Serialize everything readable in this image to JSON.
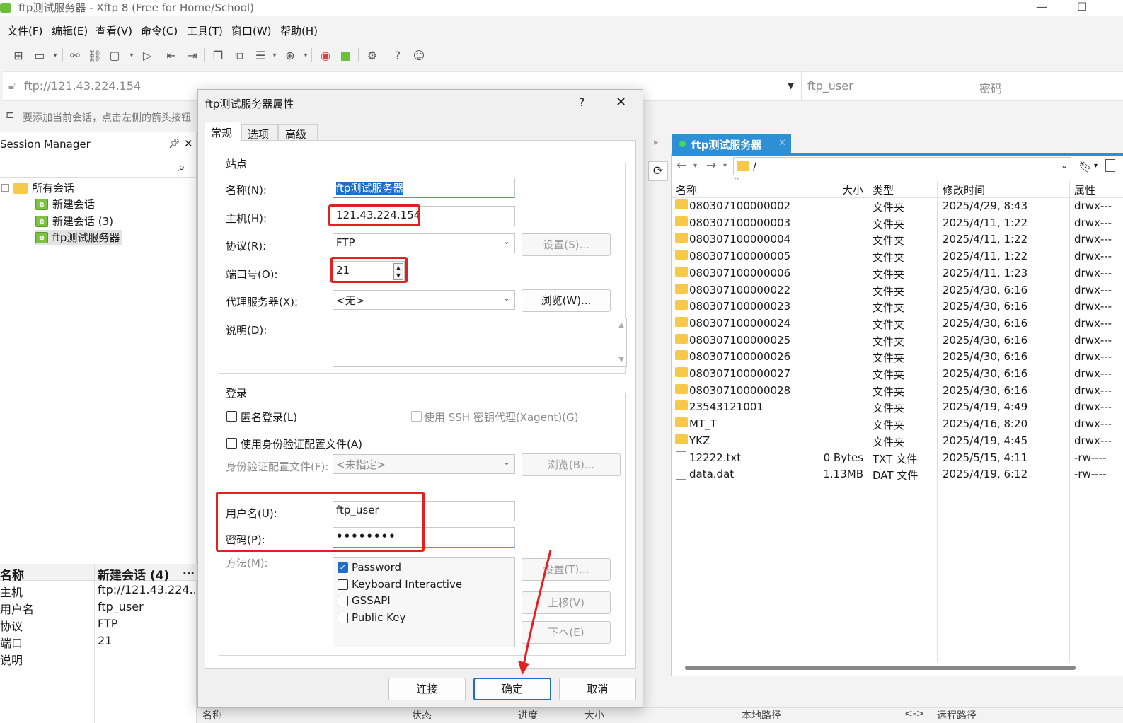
{
  "window": {
    "title": "ftp测试服务器 - Xftp 8 (Free for Home/School)",
    "minimize": "—",
    "maximize": "☐"
  },
  "menu": [
    "文件(F)",
    "编辑(E)",
    "查看(V)",
    "命令(C)",
    "工具(T)",
    "窗口(W)",
    "帮助(H)"
  ],
  "address": {
    "url": "ftp://121.43.224.154",
    "user_placeholder": "ftp_user",
    "password_placeholder": "密码"
  },
  "hint": "要添加当前会话，点击左侧的箭头按钮",
  "session_manager": {
    "title": "Session Manager",
    "tree": [
      {
        "label": "所有会话"
      },
      {
        "label": "新建会话"
      },
      {
        "label": "新建会话 (3)"
      },
      {
        "label": "ftp测试服务器"
      }
    ],
    "properties": {
      "header_key": "名称",
      "header_value": "新建会话 (4)",
      "more": "...",
      "rows": [
        {
          "k": "主机",
          "v": "ftp://121.43.224...."
        },
        {
          "k": "用户名",
          "v": "ftp_user"
        },
        {
          "k": "协议",
          "v": "FTP"
        },
        {
          "k": "端口",
          "v": "21"
        },
        {
          "k": "说明",
          "v": ""
        }
      ]
    }
  },
  "remote": {
    "tab": "ftp测试服务器",
    "path": "/",
    "columns": [
      "名称",
      "大小",
      "类型",
      "修改时间",
      "属性"
    ],
    "files": [
      {
        "name": "080307100000002",
        "size": "",
        "type": "文件夹",
        "mtime": "2025/4/29, 8:43",
        "attr": "drwx---",
        "kind": "folder"
      },
      {
        "name": "080307100000003",
        "size": "",
        "type": "文件夹",
        "mtime": "2025/4/11, 1:22",
        "attr": "drwx---",
        "kind": "folder"
      },
      {
        "name": "080307100000004",
        "size": "",
        "type": "文件夹",
        "mtime": "2025/4/11, 1:22",
        "attr": "drwx---",
        "kind": "folder"
      },
      {
        "name": "080307100000005",
        "size": "",
        "type": "文件夹",
        "mtime": "2025/4/11, 1:22",
        "attr": "drwx---",
        "kind": "folder"
      },
      {
        "name": "080307100000006",
        "size": "",
        "type": "文件夹",
        "mtime": "2025/4/11, 1:23",
        "attr": "drwx---",
        "kind": "folder"
      },
      {
        "name": "080307100000022",
        "size": "",
        "type": "文件夹",
        "mtime": "2025/4/30, 6:16",
        "attr": "drwx---",
        "kind": "folder"
      },
      {
        "name": "080307100000023",
        "size": "",
        "type": "文件夹",
        "mtime": "2025/4/30, 6:16",
        "attr": "drwx---",
        "kind": "folder"
      },
      {
        "name": "080307100000024",
        "size": "",
        "type": "文件夹",
        "mtime": "2025/4/30, 6:16",
        "attr": "drwx---",
        "kind": "folder"
      },
      {
        "name": "080307100000025",
        "size": "",
        "type": "文件夹",
        "mtime": "2025/4/30, 6:16",
        "attr": "drwx---",
        "kind": "folder"
      },
      {
        "name": "080307100000026",
        "size": "",
        "type": "文件夹",
        "mtime": "2025/4/30, 6:16",
        "attr": "drwx---",
        "kind": "folder"
      },
      {
        "name": "080307100000027",
        "size": "",
        "type": "文件夹",
        "mtime": "2025/4/30, 6:16",
        "attr": "drwx---",
        "kind": "folder"
      },
      {
        "name": "080307100000028",
        "size": "",
        "type": "文件夹",
        "mtime": "2025/4/30, 6:16",
        "attr": "drwx---",
        "kind": "folder"
      },
      {
        "name": "23543121001",
        "size": "",
        "type": "文件夹",
        "mtime": "2025/4/19, 4:49",
        "attr": "drwx---",
        "kind": "folder"
      },
      {
        "name": "MT_T",
        "size": "",
        "type": "文件夹",
        "mtime": "2025/4/16, 8:20",
        "attr": "drwx---",
        "kind": "folder"
      },
      {
        "name": "YKZ",
        "size": "",
        "type": "文件夹",
        "mtime": "2025/4/19, 4:45",
        "attr": "drwx---",
        "kind": "folder"
      },
      {
        "name": "12222.txt",
        "size": "0 Bytes",
        "type": "TXT 文件",
        "mtime": "2025/5/15, 4:11",
        "attr": "-rw----",
        "kind": "file"
      },
      {
        "name": "data.dat",
        "size": "1.13MB",
        "type": "DAT 文件",
        "mtime": "2025/4/19, 6:12",
        "attr": "-rw----",
        "kind": "file"
      }
    ]
  },
  "bottom_bar": [
    "名称",
    "状态",
    "进度",
    "大小",
    "本地路径",
    "<->",
    "远程路径"
  ],
  "dialog": {
    "title": "ftp测试服务器属性",
    "help": "?",
    "close": "✕",
    "tabs": [
      "常规",
      "选项",
      "高级"
    ],
    "site_group": "站点",
    "name_label": "名称(N):",
    "name_value": "ftp测试服务器",
    "host_label": "主机(H):",
    "host_value": "121.43.224.154",
    "protocol_label": "协议(R):",
    "protocol_value": "FTP",
    "settings_btn": "设置(S)...",
    "port_label": "端口号(O):",
    "port_value": "21",
    "proxy_label": "代理服务器(X):",
    "proxy_value": "<无>",
    "browse_btn": "浏览(W)...",
    "desc_label": "说明(D):",
    "login_group": "登录",
    "anon_label": "匿名登录(L)",
    "ssh_agent_label": "使用 SSH 密钥代理(Xagent)(G)",
    "auth_profile_chk": "使用身份验证配置文件(A)",
    "auth_profile_label": "身份验证配置文件(F):",
    "auth_profile_value": "<未指定>",
    "browse2_btn": "浏览(B)...",
    "user_label": "用户名(U):",
    "user_value": "ftp_user",
    "pass_label": "密码(P):",
    "pass_value": "••••••••",
    "method_label": "方法(M):",
    "methods": [
      {
        "label": "Password",
        "checked": true
      },
      {
        "label": "Keyboard Interactive",
        "checked": false
      },
      {
        "label": "GSSAPI",
        "checked": false
      },
      {
        "label": "Public Key",
        "checked": false
      }
    ],
    "method_settings_btn": "设置(T)...",
    "up_btn": "上移(V)",
    "down_btn": "下へ(E)",
    "connect_btn": "连接",
    "ok_btn": "确定",
    "cancel_btn": "取消"
  },
  "colors": {
    "accent": "#2d8fd6",
    "highlight": "#e32020",
    "session_green": "#7dc242",
    "folder": "#f7c948"
  }
}
